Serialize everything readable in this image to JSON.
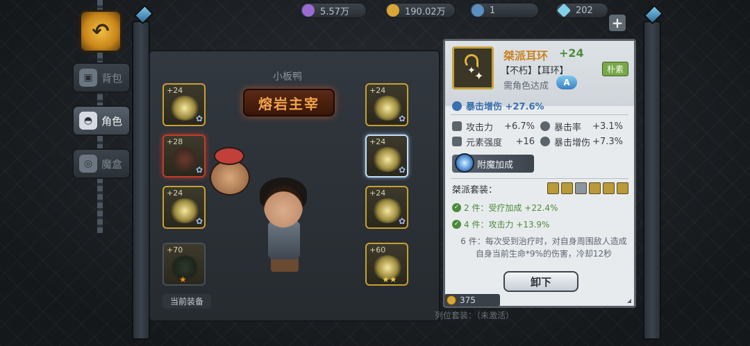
{
  "currencies": [
    {
      "name": "purple-gem",
      "value": "5.57万",
      "color": "#9b6bd1"
    },
    {
      "name": "gold-coin",
      "value": "190.02万",
      "color": "#d9a635"
    },
    {
      "name": "blue-token",
      "value": "1",
      "color": "#5a8fc0"
    },
    {
      "name": "diamond",
      "value": "202",
      "color": "#7fd0e8"
    }
  ],
  "side_tabs": [
    {
      "label": "背包",
      "icon": "backpack-icon",
      "active": false
    },
    {
      "label": "角色",
      "icon": "helmet-icon",
      "active": true
    },
    {
      "label": "魔盒",
      "icon": "magic-box-icon",
      "active": false
    }
  ],
  "character": {
    "name": "小板鸭",
    "title": "熔岩主宰"
  },
  "slots_left": [
    {
      "level": "+24",
      "state": "gold"
    },
    {
      "level": "+28",
      "state": "red"
    },
    {
      "level": "+24",
      "state": "gold"
    },
    {
      "level": "+70",
      "state": "dark"
    }
  ],
  "slots_right": [
    {
      "level": "+24",
      "state": "gold"
    },
    {
      "level": "+24",
      "state": "selected"
    },
    {
      "level": "+24",
      "state": "gold"
    },
    {
      "level": "+60",
      "state": "gold"
    }
  ],
  "current_equip_label": "当前装备",
  "item": {
    "name": "桀派耳环",
    "enhance": "+24",
    "tags": "【不朽】【耳环】",
    "quality": "朴素",
    "requirement": "需角色达成",
    "req_rank": "A",
    "main_stat": "暴击增伤 +27.6%",
    "sub_stats": [
      [
        {
          "label": "攻击力",
          "value": "+6.7%"
        },
        {
          "label": "暴击率",
          "value": "+3.1%"
        }
      ],
      [
        {
          "label": "元素强度",
          "value": "+16"
        },
        {
          "label": "暴击增伤",
          "value": "+7.3%"
        }
      ]
    ],
    "enchant_label": "附魔加成",
    "set_title": "桀派套装：",
    "set_2": "2 件：受疗加成 +22.4%",
    "set_4": "4 件：攻击力 +13.9%",
    "set_6": "6 件：每次受到治疗时，对自身周围敌人造成自身当前生命*9%的伤害，冷却12秒",
    "unequip_label": "卸下",
    "price": "375"
  },
  "bottom_hint": "列位套装：（未激活）"
}
